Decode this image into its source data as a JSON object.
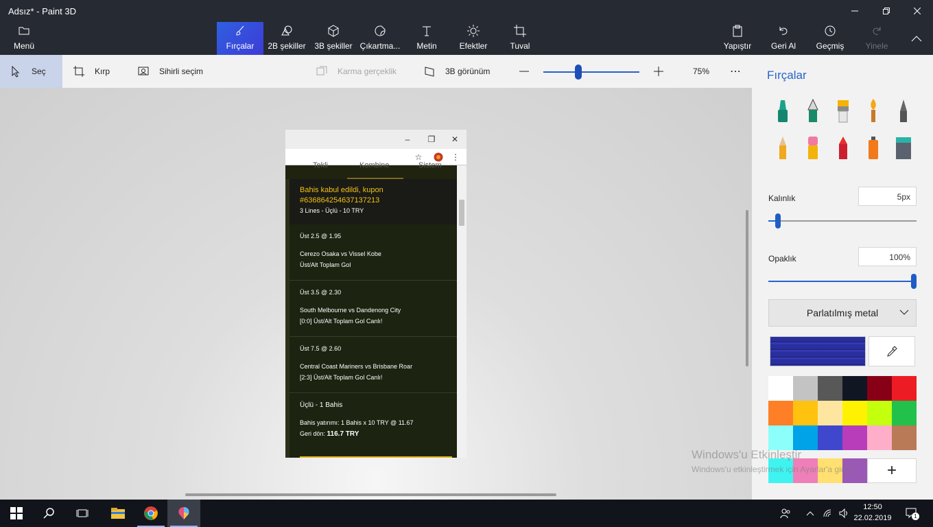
{
  "window": {
    "title": "Adsız* - Paint 3D"
  },
  "ribbon": {
    "menu": "Menü",
    "brushes": "Fırçalar",
    "shapes2d": "2B şekiller",
    "shapes3d": "3B şekiller",
    "stickers": "Çıkartma...",
    "text": "Metin",
    "effects": "Efektler",
    "canvas": "Tuval",
    "paste": "Yapıştır",
    "undo": "Geri Al",
    "history": "Geçmiş",
    "redo": "Yinele"
  },
  "toolbar": {
    "select": "Seç",
    "crop": "Kırp",
    "magic_select": "Sihirli seçim",
    "mixed_reality": "Karma gerçeklik",
    "view3d": "3B görünüm",
    "zoom": "75%",
    "zoom_fraction": 0.33
  },
  "shot": {
    "tabs": [
      "Tekli",
      "Kombine",
      "Sistem"
    ],
    "accepted_line1": "Bahis kabul edildi, kupon",
    "accepted_line2": "#636864254637137213",
    "accepted_detail": "3 Lines - Üçlü - 10 TRY",
    "bets": [
      {
        "odd": "Üst 2.5  @ 1.95",
        "match": "Cerezo Osaka vs Vissel Kobe",
        "market": "Üst/Alt Toplam Gol"
      },
      {
        "odd": "Üst 3.5  @ 2.30",
        "match": "South Melbourne vs Dandenong City",
        "market": "[0:0] Üst/Alt Toplam Gol Canlı!"
      },
      {
        "odd": "Üst 7.5  @ 2.60",
        "match": "Central Coast Mariners vs Brisbane Roar",
        "market": "[2:3] Üst/Alt Toplam Gol Canlı!"
      }
    ],
    "summary_title": "Üçlü - 1 Bahis",
    "summary_stake": "Bahis yatırımı:  1 Bahis x 10 TRY  @ 11.67",
    "summary_return_label": "Geri dön: ",
    "summary_return_value": "116.7 TRY"
  },
  "panel": {
    "title": "Fırçalar",
    "thickness_label": "Kalınlık",
    "thickness_value": "5px",
    "thickness_fraction": 0.05,
    "opacity_label": "Opaklık",
    "opacity_value": "100%",
    "opacity_fraction": 1.0,
    "material": "Parlatılmış metal",
    "brush_icons": [
      "marker-icon",
      "calligraphy-pen-icon",
      "oil-brush-icon",
      "watercolor-icon",
      "pixel-pen-icon",
      "pencil-icon",
      "eraser-icon",
      "crayon-icon",
      "spray-can-icon",
      "fill-bucket-icon"
    ],
    "swatches": [
      "#ffffff",
      "#c3c3c3",
      "#585858",
      "#111722",
      "#880015",
      "#ed1c24",
      "#ff7f27",
      "#ffc20e",
      "#ffe6a0",
      "#fff200",
      "#c4ff0e",
      "#22c14c",
      "#8cfffb",
      "#00a2e8",
      "#3f48cc",
      "#b83dba",
      "#ffaec9",
      "#b97a57"
    ],
    "custom_swatches": [
      "#3ff4f0",
      "#ee7fb8",
      "#ffe070",
      "#9b59b6"
    ]
  },
  "watermark": {
    "line1": "Windows'u Etkinleştir",
    "line2": "Windows'u etkinleştirmek için Ayarlar'a gidin."
  },
  "taskbar": {
    "time": "12:50",
    "date": "22.02.2019",
    "notifications": "1"
  }
}
